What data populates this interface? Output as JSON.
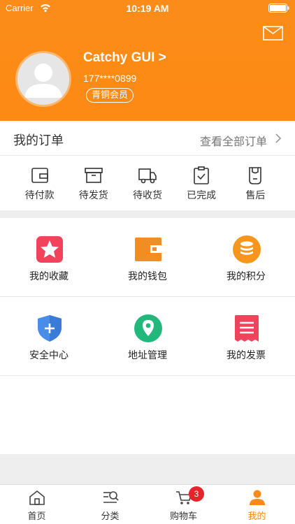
{
  "status_bar": {
    "carrier": "Carrier",
    "time": "10:19 AM"
  },
  "profile": {
    "username": "Catchy GUI >",
    "phone": "177****0899",
    "member_level": "青铜会员"
  },
  "orders": {
    "title": "我的订单",
    "view_all": "查看全部订单",
    "statuses": [
      {
        "label": "待付款",
        "icon": "wallet-icon"
      },
      {
        "label": "待发货",
        "icon": "box-icon"
      },
      {
        "label": "待收货",
        "icon": "truck-icon"
      },
      {
        "label": "已完成",
        "icon": "clipboard-check-icon"
      },
      {
        "label": "售后",
        "icon": "after-sale-icon"
      }
    ]
  },
  "services": [
    {
      "label": "我的收藏",
      "icon": "star-icon",
      "color": "#f2435c"
    },
    {
      "label": "我的钱包",
      "icon": "wallet-icon",
      "color": "#f08e23"
    },
    {
      "label": "我的积分",
      "icon": "coins-icon",
      "color": "#f7951c"
    },
    {
      "label": "安全中心",
      "icon": "shield-icon",
      "color": "#4a8de8"
    },
    {
      "label": "地址管理",
      "icon": "location-pin-icon",
      "color": "#22b87c"
    },
    {
      "label": "我的发票",
      "icon": "invoice-icon",
      "color": "#f2435c"
    }
  ],
  "tab_bar": {
    "tabs": [
      {
        "label": "首页",
        "icon": "home-icon"
      },
      {
        "label": "分类",
        "icon": "category-search-icon"
      },
      {
        "label": "购物车",
        "icon": "cart-icon"
      },
      {
        "label": "我的",
        "icon": "person-icon"
      }
    ],
    "active_index": 3,
    "cart_count": "3"
  },
  "colors": {
    "brand": "#fd8a13",
    "badge": "#e8232c"
  }
}
